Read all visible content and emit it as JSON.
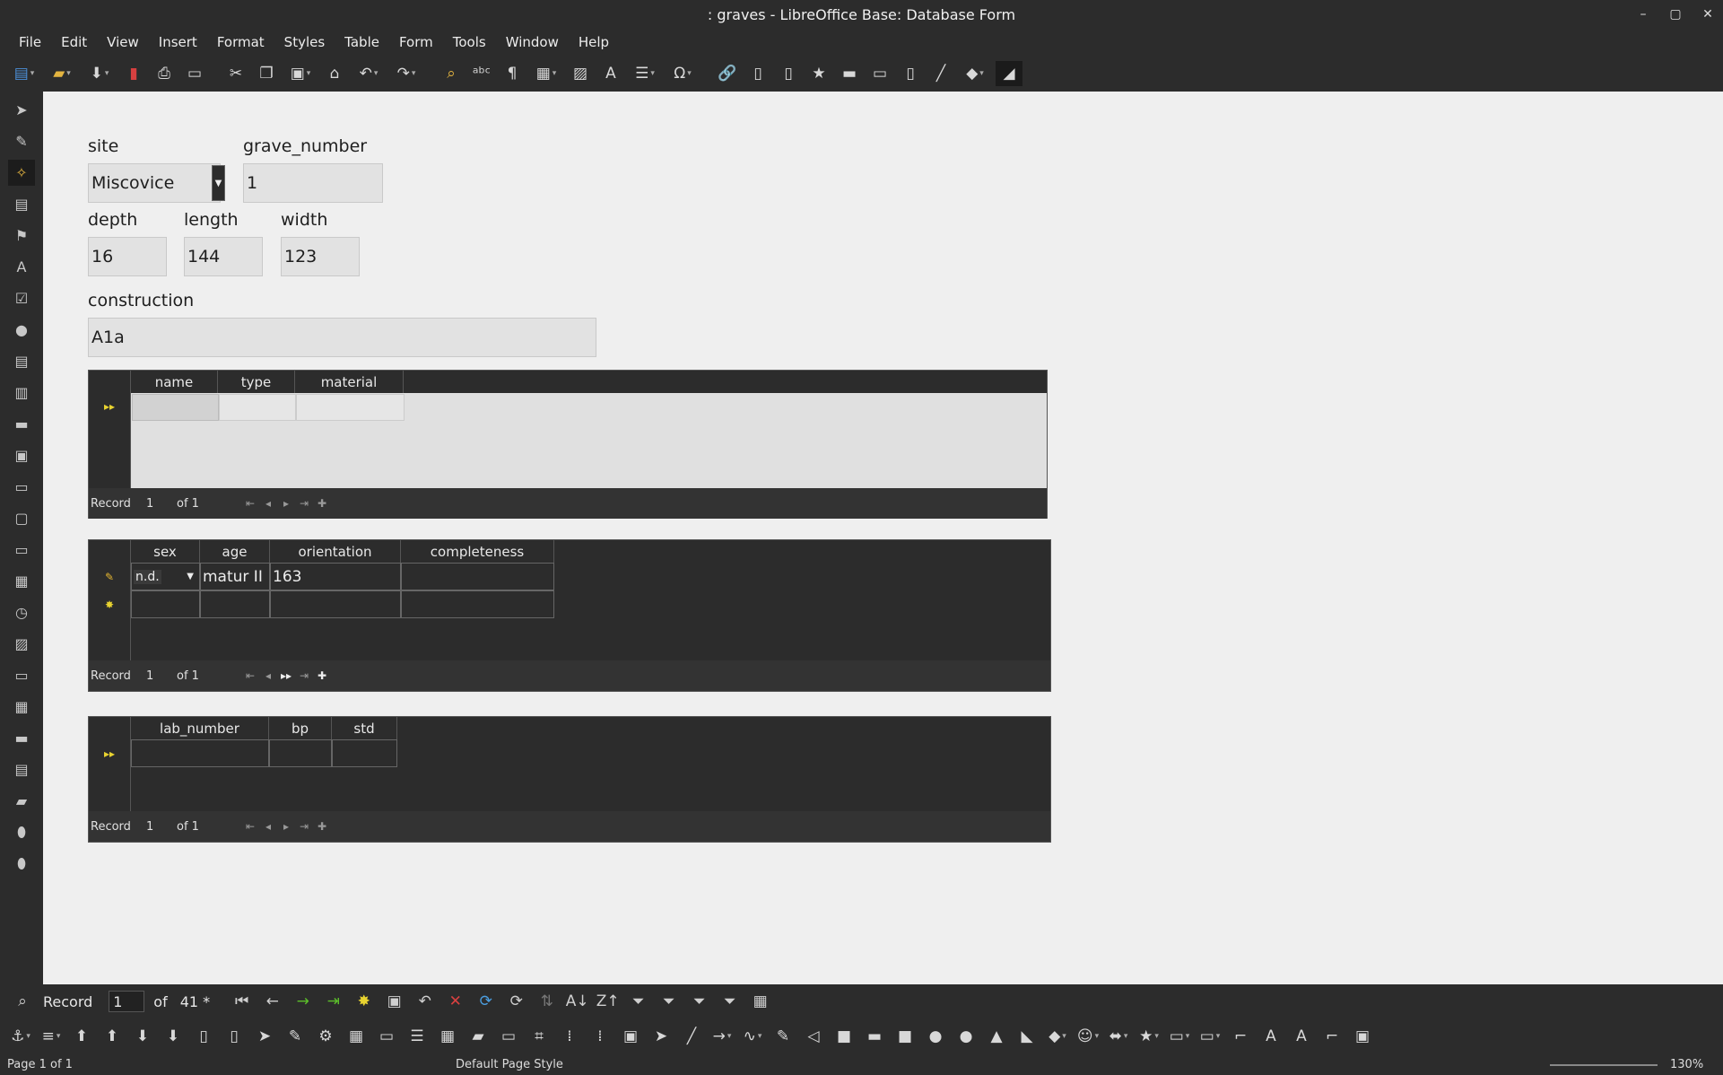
{
  "window": {
    "title": ": graves - LibreOffice Base: Database Form",
    "controls": [
      "–",
      "▢",
      "✕"
    ]
  },
  "menu": [
    "File",
    "Edit",
    "View",
    "Insert",
    "Format",
    "Styles",
    "Table",
    "Form",
    "Tools",
    "Window",
    "Help"
  ],
  "form": {
    "site": {
      "label": "site",
      "value": "Miscovice"
    },
    "grave_number": {
      "label": "grave_number",
      "value": "1"
    },
    "depth": {
      "label": "depth",
      "value": "16"
    },
    "length": {
      "label": "length",
      "value": "144"
    },
    "width": {
      "label": "width",
      "value": "123"
    },
    "construction": {
      "label": "construction",
      "value": "A1a"
    }
  },
  "grid1": {
    "columns": [
      "name",
      "type",
      "material"
    ],
    "nav": {
      "label": "Record",
      "current": "1",
      "of": "of 1"
    }
  },
  "grid2": {
    "columns": [
      "sex",
      "age",
      "orientation",
      "completeness"
    ],
    "row1": {
      "sex": "n.d.",
      "age": "matur II",
      "orientation": "163",
      "completeness": ""
    },
    "nav": {
      "label": "Record",
      "current": "1",
      "of": "of 1"
    }
  },
  "grid3": {
    "columns": [
      "lab_number",
      "bp",
      "std"
    ],
    "nav": {
      "label": "Record",
      "current": "1",
      "of": "of 1"
    }
  },
  "formnav": {
    "label": "Record",
    "current": "1",
    "of": "of",
    "total": "41 *"
  },
  "status": {
    "page": "Page 1 of 1",
    "style": "Default Page Style",
    "zoom": "130%"
  }
}
